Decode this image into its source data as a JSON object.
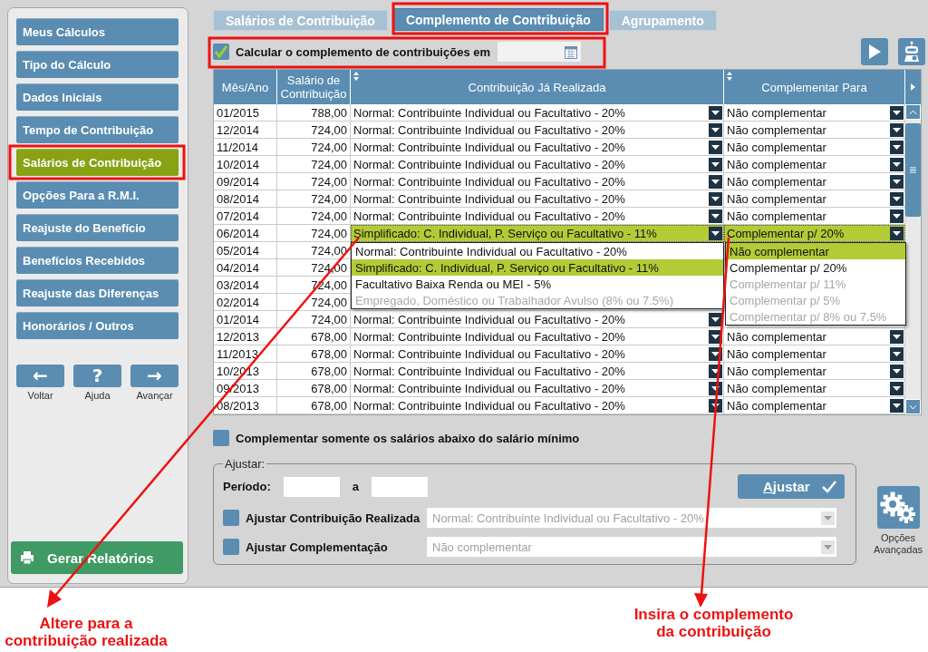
{
  "sidebar": {
    "items": [
      {
        "label": "Meus Cálculos",
        "selected": false
      },
      {
        "label": "Tipo do Cálculo",
        "selected": false
      },
      {
        "label": "Dados Iniciais",
        "selected": false
      },
      {
        "label": "Tempo de Contribuição",
        "selected": false
      },
      {
        "label": "Salários de Contribuição",
        "selected": true
      },
      {
        "label": "Opções Para a R.M.I.",
        "selected": false
      },
      {
        "label": "Reajuste do Benefício",
        "selected": false
      },
      {
        "label": "Benefícios Recebidos",
        "selected": false
      },
      {
        "label": "Reajuste das Diferenças",
        "selected": false
      },
      {
        "label": "Honorários / Outros",
        "selected": false
      }
    ],
    "nav_buttons": [
      {
        "symbol": "←",
        "label": "Voltar"
      },
      {
        "symbol": "?",
        "label": "Ajuda"
      },
      {
        "symbol": "→",
        "label": "Avançar"
      }
    ],
    "report_button": "Gerar Relatórios"
  },
  "tabs": [
    {
      "label": "Salários de Contribuição",
      "selected": false
    },
    {
      "label": "Complemento de Contribuição",
      "selected": true
    },
    {
      "label": "Agrupamento",
      "selected": false
    }
  ],
  "calc_option": {
    "label": "Calcular o complemento de contribuições em",
    "checked": true
  },
  "table": {
    "columns": [
      "Mês/Ano",
      "Salário de Contribuição",
      "Contribuição Já Realizada",
      "Complementar Para"
    ],
    "rows": [
      {
        "month": "01/2015",
        "salary": "788,00",
        "contribution": "Normal: Contribuinte Individual ou Facultativo - 20%",
        "complement": "Não complementar",
        "selected": false
      },
      {
        "month": "12/2014",
        "salary": "724,00",
        "contribution": "Normal: Contribuinte Individual ou Facultativo - 20%",
        "complement": "Não complementar",
        "selected": false
      },
      {
        "month": "11/2014",
        "salary": "724,00",
        "contribution": "Normal: Contribuinte Individual ou Facultativo - 20%",
        "complement": "Não complementar",
        "selected": false
      },
      {
        "month": "10/2014",
        "salary": "724,00",
        "contribution": "Normal: Contribuinte Individual ou Facultativo - 20%",
        "complement": "Não complementar",
        "selected": false
      },
      {
        "month": "09/2014",
        "salary": "724,00",
        "contribution": "Normal: Contribuinte Individual ou Facultativo - 20%",
        "complement": "Não complementar",
        "selected": false
      },
      {
        "month": "08/2014",
        "salary": "724,00",
        "contribution": "Normal: Contribuinte Individual ou Facultativo - 20%",
        "complement": "Não complementar",
        "selected": false
      },
      {
        "month": "07/2014",
        "salary": "724,00",
        "contribution": "Normal: Contribuinte Individual ou Facultativo - 20%",
        "complement": "Não complementar",
        "selected": false
      },
      {
        "month": "06/2014",
        "salary": "724,00",
        "contribution": "Simplificado: C. Individual, P. Serviço ou Facultativo - 11%",
        "complement": "Complementar p/ 20%",
        "selected": true
      },
      {
        "month": "05/2014",
        "salary": "724,00"
      },
      {
        "month": "04/2014",
        "salary": "724,00"
      },
      {
        "month": "03/2014",
        "salary": "724,00"
      },
      {
        "month": "02/2014",
        "salary": "724,00"
      },
      {
        "month": "01/2014",
        "salary": "724,00",
        "contribution": "Normal: Contribuinte Individual ou Facultativo - 20%",
        "selected": false
      },
      {
        "month": "12/2013",
        "salary": "678,00",
        "contribution": "Normal: Contribuinte Individual ou Facultativo - 20%",
        "complement": "Não complementar",
        "selected": false
      },
      {
        "month": "11/2013",
        "salary": "678,00",
        "contribution": "Normal: Contribuinte Individual ou Facultativo - 20%",
        "complement": "Não complementar",
        "selected": false
      },
      {
        "month": "10/2013",
        "salary": "678,00",
        "contribution": "Normal: Contribuinte Individual ou Facultativo - 20%",
        "complement": "Não complementar",
        "selected": false
      },
      {
        "month": "09/2013",
        "salary": "678,00",
        "contribution": "Normal: Contribuinte Individual ou Facultativo - 20%",
        "complement": "Não complementar",
        "selected": false
      },
      {
        "month": "08/2013",
        "salary": "678,00",
        "contribution": "Normal: Contribuinte Individual ou Facultativo - 20%",
        "complement": "Não complementar",
        "selected": false
      }
    ]
  },
  "contribution_dropdown": {
    "options": [
      {
        "label": "Normal: Contribuinte Individual ou Facultativo - 20%",
        "selected": false,
        "disabled": false
      },
      {
        "label": "Simplificado: C. Individual, P. Serviço ou Facultativo - 11%",
        "selected": true,
        "disabled": false
      },
      {
        "label": "Facultativo Baixa Renda ou MEI - 5%",
        "selected": false,
        "disabled": false
      },
      {
        "label": "Empregado, Doméstico ou Trabalhador Avulso (8% ou 7.5%)",
        "selected": false,
        "disabled": true
      }
    ]
  },
  "complement_dropdown": {
    "options": [
      {
        "label": "Não complementar",
        "selected": true,
        "disabled": false
      },
      {
        "label": "Complementar p/ 20%",
        "selected": false,
        "disabled": false
      },
      {
        "label": "Complementar p/ 11%",
        "selected": false,
        "disabled": true
      },
      {
        "label": "Complementar p/ 5%",
        "selected": false,
        "disabled": true
      },
      {
        "label": "Complementar p/ 8% ou 7.5%",
        "selected": false,
        "disabled": true
      }
    ]
  },
  "min_wage_option": {
    "label": "Complementar somente os salários abaixo do salário mínimo",
    "checked": false
  },
  "adjust": {
    "title": "Ajustar:",
    "period_label": "Período:",
    "separator": "a",
    "button": "Ajustar",
    "rows": [
      {
        "label": "Ajustar Contribuição Realizada",
        "checked": false,
        "value": "Normal: Contribuinte Individual ou Facultativo - 20%",
        "disabled": true
      },
      {
        "label": "Ajustar Complementação",
        "checked": false,
        "value": "Não complementar",
        "disabled": true
      }
    ]
  },
  "advanced_button": "Opções Avançadas",
  "annotations": [
    {
      "text": "Altere para a contribuição realizada"
    },
    {
      "text": "Insira o complemento da contribuição"
    }
  ]
}
